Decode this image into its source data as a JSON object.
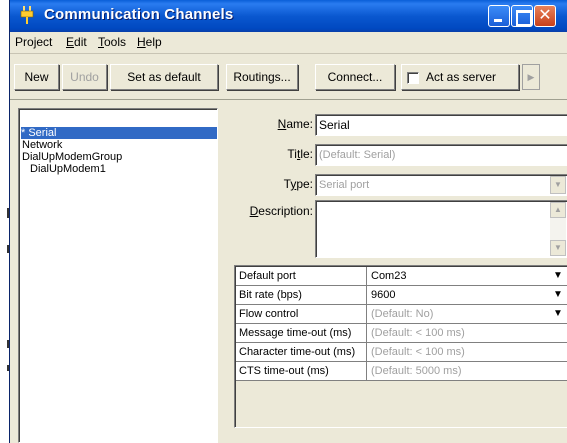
{
  "window": {
    "title": "Communication Channels"
  },
  "menu": {
    "items": [
      {
        "label": "Project",
        "accel_index": 3
      },
      {
        "label": "Edit",
        "accel_index": 0
      },
      {
        "label": "Tools",
        "accel_index": 0
      },
      {
        "label": "Help",
        "accel_index": 0
      }
    ]
  },
  "toolbar": {
    "new_label": "New",
    "undo_label": "Undo",
    "set_default_label": "Set as default",
    "routings_label": "Routings...",
    "connect_label": "Connect...",
    "act_as_server_label": "Act as server",
    "act_as_server_checked": false
  },
  "tree": {
    "items": [
      {
        "label": "* Serial",
        "selected": true,
        "indent": 0
      },
      {
        "label": "Network",
        "selected": false,
        "indent": 0
      },
      {
        "label": "DialUpModemGroup",
        "selected": false,
        "indent": 0
      },
      {
        "label": "DialUpModem1",
        "selected": false,
        "indent": 1
      }
    ]
  },
  "form": {
    "name_label": "Name:",
    "name_value": "Serial",
    "title_label": "Title:",
    "title_placeholder": "(Default: Serial)",
    "type_label": "Type:",
    "type_value": "Serial port",
    "description_label": "Description:",
    "description_value": ""
  },
  "properties": [
    {
      "name": "Default port",
      "value": "Com23",
      "dropdown": true,
      "disabled": false
    },
    {
      "name": "Bit rate (bps)",
      "value": "9600",
      "dropdown": true,
      "disabled": false
    },
    {
      "name": "Flow control",
      "value": "(Default: No)",
      "dropdown": true,
      "disabled": true
    },
    {
      "name": "Message time-out (ms)",
      "value": "(Default: < 100 ms)",
      "dropdown": false,
      "disabled": true
    },
    {
      "name": "Character time-out (ms)",
      "value": "(Default: < 100 ms)",
      "dropdown": false,
      "disabled": true
    },
    {
      "name": "CTS time-out (ms)",
      "value": "(Default: 5000 ms)",
      "dropdown": false,
      "disabled": true
    }
  ],
  "colors": {
    "titlebar": "#0a58d0",
    "selection": "#316ac5",
    "window_bg": "#ece9d8",
    "close_button": "#c8401a"
  },
  "icons": {
    "title": "plug-icon",
    "minimize": "minimize-icon",
    "maximize": "maximize-icon",
    "close": "close-icon"
  }
}
